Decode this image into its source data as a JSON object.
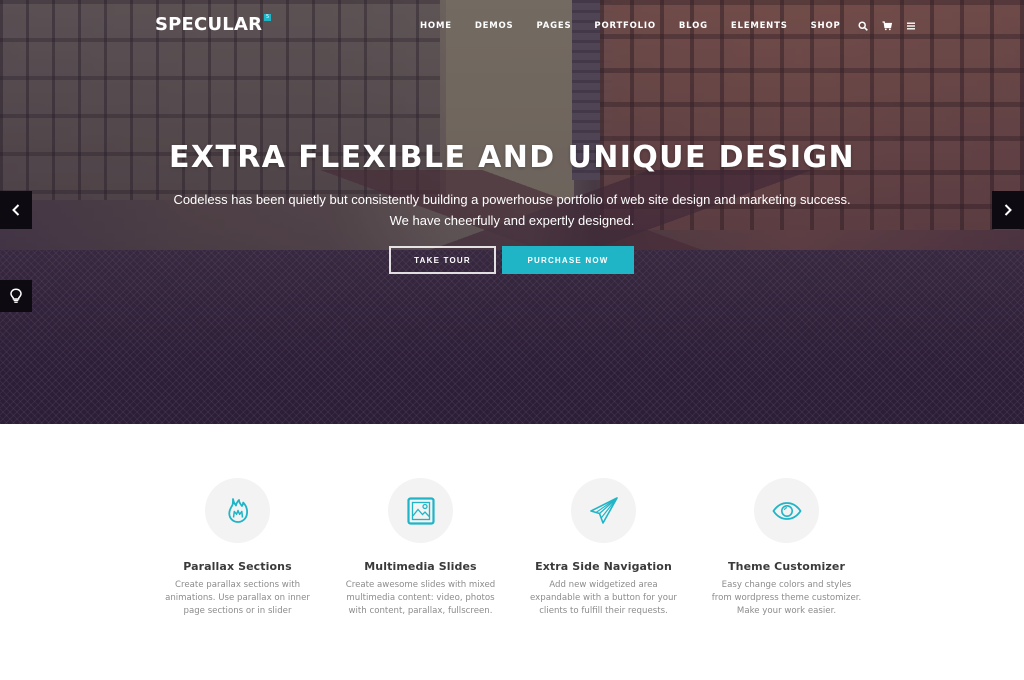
{
  "brand": {
    "logo_text": "SPECULAR",
    "logo_badge": "5",
    "accent_color": "#1fb5c7"
  },
  "nav": {
    "items": [
      {
        "label": "HOME"
      },
      {
        "label": "DEMOS"
      },
      {
        "label": "PAGES"
      },
      {
        "label": "PORTFOLIO"
      },
      {
        "label": "BLOG"
      },
      {
        "label": "ELEMENTS"
      },
      {
        "label": "SHOP"
      }
    ],
    "icons": [
      "search-icon",
      "cart-icon",
      "menu-icon"
    ]
  },
  "hero": {
    "title": "EXTRA FLEXIBLE AND UNIQUE DESIGN",
    "subtitle_line1": "Codeless has been quietly but consistently building a powerhouse portfolio of web site design and marketing success.",
    "subtitle_line2": "We have cheerfully and expertly designed.",
    "buttons": {
      "tour": "TAKE TOUR",
      "purchase": "PURCHASE NOW"
    },
    "controls": {
      "prev": "chevron-left-icon",
      "next": "chevron-right-icon",
      "side": "lightbulb-icon"
    }
  },
  "features": [
    {
      "icon": "flame-icon",
      "title": "Parallax Sections",
      "desc": "Create parallax sections with animations. Use parallax on inner page sections or in slider"
    },
    {
      "icon": "image-icon",
      "title": "Multimedia Slides",
      "desc": "Create awesome slides with mixed multimedia content: video, photos with content, parallax, fullscreen."
    },
    {
      "icon": "paper-plane-icon",
      "title": "Extra Side Navigation",
      "desc": "Add new widgetized area expandable with a button for your clients to fulfill their requests."
    },
    {
      "icon": "eye-icon",
      "title": "Theme Customizer",
      "desc": "Easy change colors and styles from wordpress theme customizer. Make your work easier."
    }
  ]
}
